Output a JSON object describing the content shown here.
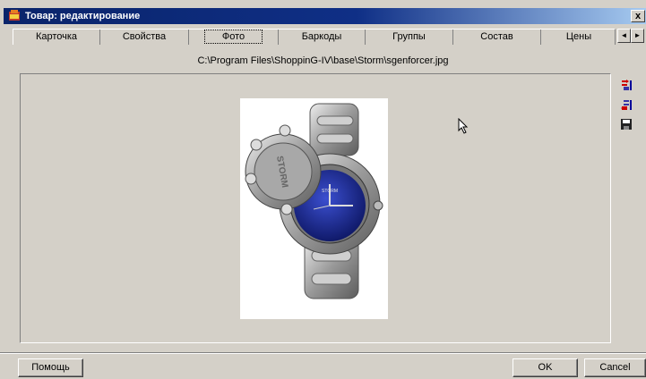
{
  "window": {
    "title": "Товар: редактирование",
    "close_label": "x"
  },
  "tabs": [
    {
      "label": "Карточка"
    },
    {
      "label": "Свойства"
    },
    {
      "label": "Фото",
      "active": true
    },
    {
      "label": "Баркоды"
    },
    {
      "label": "Группы"
    },
    {
      "label": "Состав"
    },
    {
      "label": "Цены"
    }
  ],
  "tab_scroll": {
    "left_label": "◄",
    "right_label": "►"
  },
  "photo": {
    "file_path": "C:\\Program Files\\ShoppinG-IV\\base\\Storm\\sgenforcer.jpg",
    "brand_text": "STORM",
    "dial_color": "#1f2f9a"
  },
  "side_tools": [
    {
      "name": "load-image-icon"
    },
    {
      "name": "clear-image-icon"
    },
    {
      "name": "save-image-icon"
    }
  ],
  "footer": {
    "help_label": "Помощь",
    "ok_label": "OK",
    "cancel_label": "Cancel"
  }
}
